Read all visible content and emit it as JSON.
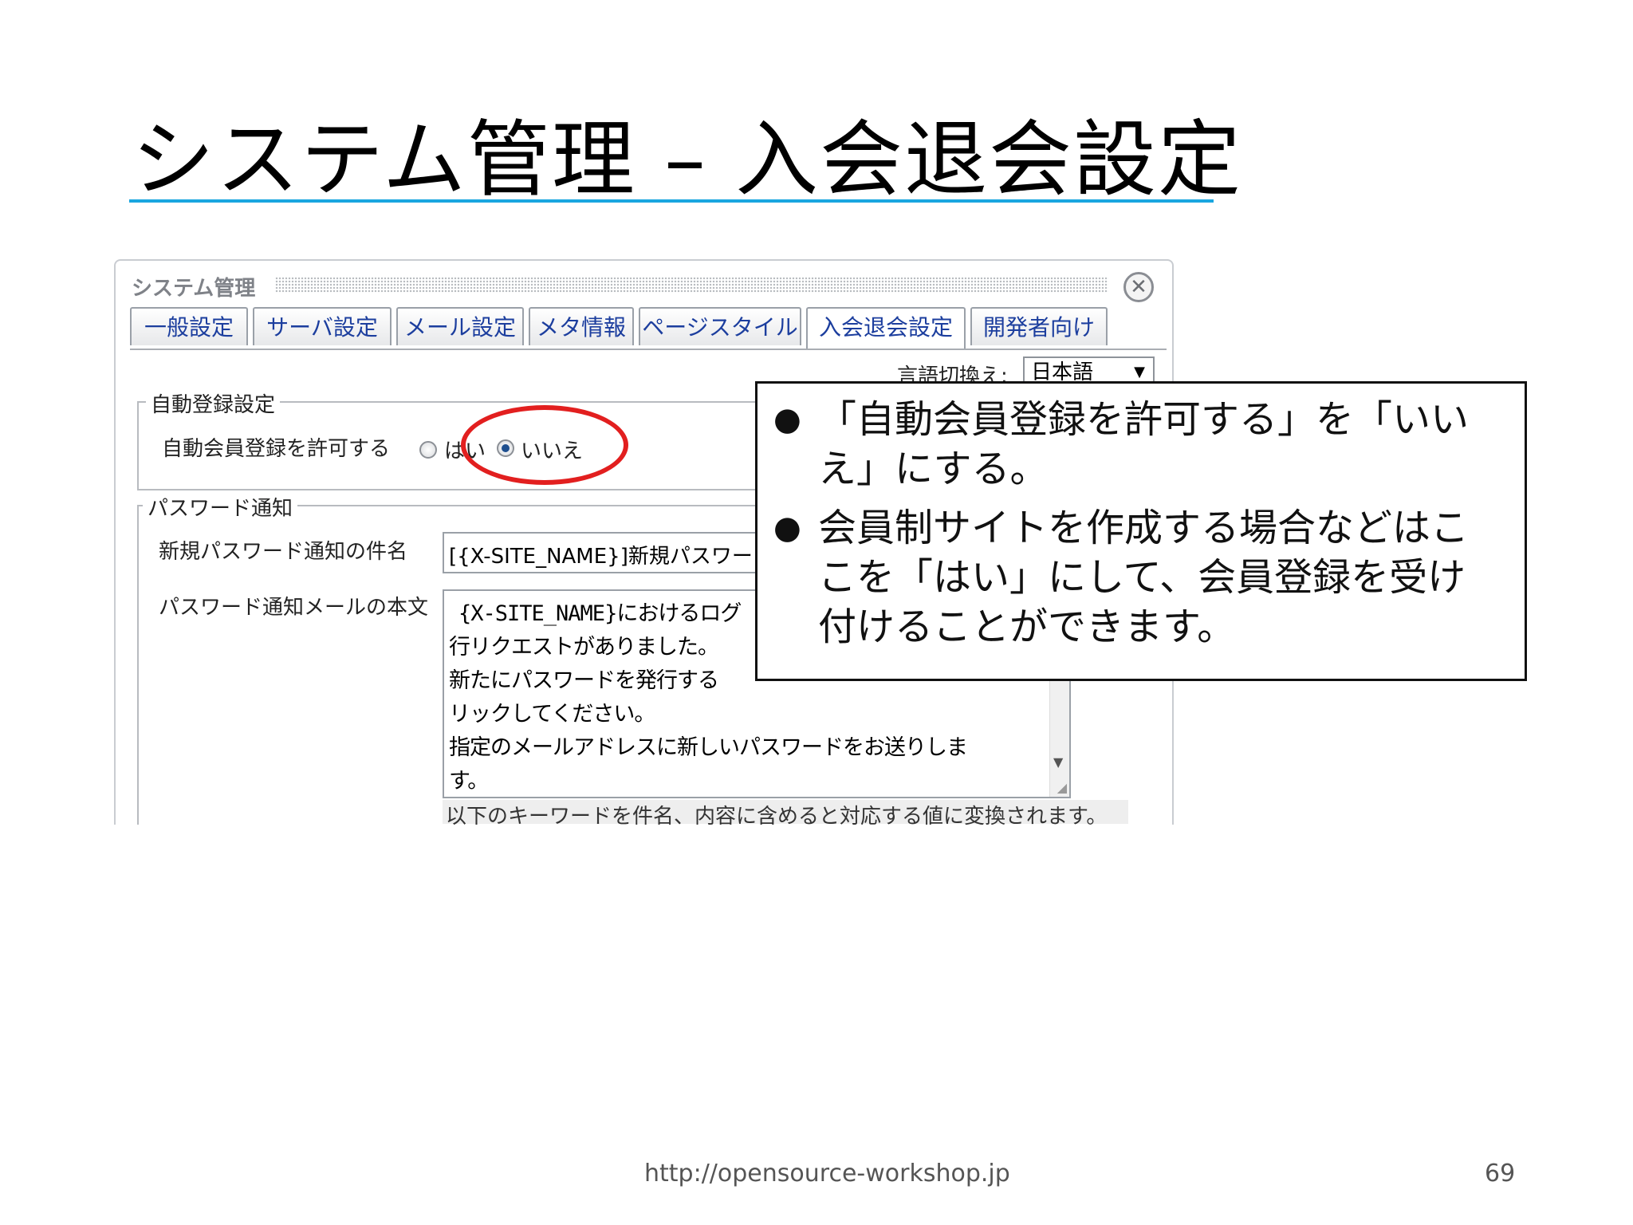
{
  "slide": {
    "title": "システム管理 – 入会退会設定",
    "footer_url": "http://opensource-workshop.jp",
    "page_number": "69"
  },
  "panel": {
    "title": "システム管理",
    "close_icon": "close-icon",
    "tabs": [
      {
        "label": "一般設定"
      },
      {
        "label": "サーバ設定"
      },
      {
        "label": "メール設定"
      },
      {
        "label": "メタ情報"
      },
      {
        "label": "ページスタイル"
      },
      {
        "label": "入会退会設定",
        "active": true
      },
      {
        "label": "開発者向け"
      }
    ],
    "language": {
      "label": "言語切換え:",
      "selected": "日本語"
    },
    "auto_register": {
      "legend": "自動登録設定",
      "field_label": "自動会員登録を許可する",
      "options": [
        "はい",
        "いいえ"
      ],
      "selected": "いいえ"
    },
    "password_notice": {
      "legend": "パスワード通知",
      "subject_label": "新規パスワード通知の件名",
      "subject_value": "[{X-SITE_NAME}]新規パスワードの",
      "body_label": "パスワード通知メールの本文",
      "body_lines": [
        "{X-SITE_NAME}におけるログ",
        "行リクエストがありました。",
        "新たにパスワードを発行する",
        "リックしてください。",
        "指定のメールアドレスに新しいパスワードをお送りしま",
        "す。"
      ],
      "hint": "以下のキーワードを件名、内容に含めると対応する値に変換されます。"
    }
  },
  "callout": {
    "items": [
      {
        "lines": [
          "「自動会員登録を許可する」を「いい",
          "え」にする。"
        ]
      },
      {
        "lines": [
          "会員制サイトを作成する場合などはこ",
          "こを「はい」にして、会員登録を受け",
          "付けることができます。"
        ]
      }
    ],
    "bullet": "●"
  },
  "colors": {
    "title_rule": "#19a6e0",
    "tab_text": "#1c3e9e",
    "highlight_ellipse": "#e21f1f"
  }
}
